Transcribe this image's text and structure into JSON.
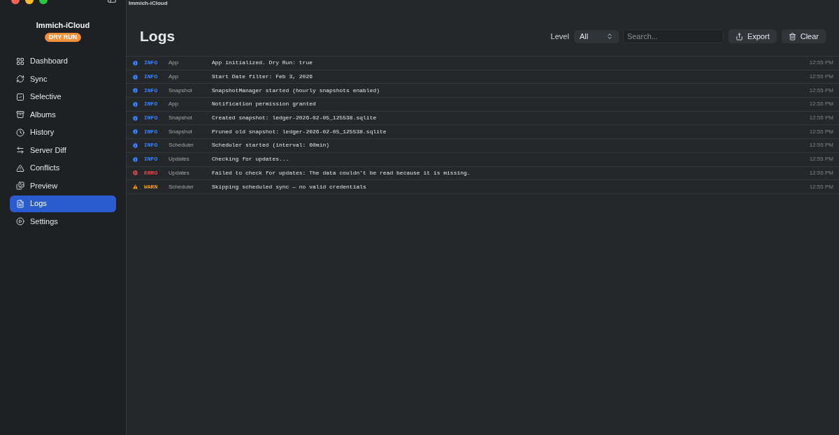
{
  "window": {
    "title": "Immich-iCloud"
  },
  "sidebar": {
    "app_name": "Immich-iCloud",
    "badge": "DRY RUN",
    "items": [
      {
        "label": "Dashboard",
        "selected": false
      },
      {
        "label": "Sync",
        "selected": false
      },
      {
        "label": "Selective",
        "selected": false
      },
      {
        "label": "Albums",
        "selected": false
      },
      {
        "label": "History",
        "selected": false
      },
      {
        "label": "Server Diff",
        "selected": false
      },
      {
        "label": "Conflicts",
        "selected": false
      },
      {
        "label": "Preview",
        "selected": false
      },
      {
        "label": "Logs",
        "selected": true
      },
      {
        "label": "Settings",
        "selected": false
      }
    ]
  },
  "header": {
    "title": "Logs",
    "level_label": "Level",
    "level_value": "All",
    "search": {
      "placeholder": "Search..."
    },
    "buttons": [
      {
        "label": "Export",
        "kind": "export"
      },
      {
        "label": "Clear",
        "kind": "clear"
      }
    ]
  },
  "logs": [
    {
      "kind": "info",
      "level": "INFO",
      "source": "App",
      "message": "App initialized. Dry Run: true",
      "time": "12:55 PM"
    },
    {
      "kind": "info",
      "level": "INFO",
      "source": "App",
      "message": "Start Date filter: Feb 3, 2026",
      "time": "12:55 PM"
    },
    {
      "kind": "info",
      "level": "INFO",
      "source": "Snapshot",
      "message": "SnapshotManager started (hourly snapshots enabled)",
      "time": "12:55 PM"
    },
    {
      "kind": "info",
      "level": "INFO",
      "source": "App",
      "message": "Notification permission granted",
      "time": "12:55 PM"
    },
    {
      "kind": "info",
      "level": "INFO",
      "source": "Snapshot",
      "message": "Created snapshot: ledger-2026-02-05_125538.sqlite",
      "time": "12:55 PM"
    },
    {
      "kind": "info",
      "level": "INFO",
      "source": "Snapshot",
      "message": "Pruned old snapshot: ledger-2026-02-05_125538.sqlite",
      "time": "12:55 PM"
    },
    {
      "kind": "info",
      "level": "INFO",
      "source": "Scheduler",
      "message": "Scheduler started (interval: 60min)",
      "time": "12:55 PM"
    },
    {
      "kind": "info",
      "level": "INFO",
      "source": "Updates",
      "message": "Checking for updates...",
      "time": "12:55 PM"
    },
    {
      "kind": "error",
      "level": "ERRO",
      "source": "Updates",
      "message": "Failed to check for updates: The data couldn’t be read because it is missing.",
      "time": "12:55 PM"
    },
    {
      "kind": "warn",
      "level": "WARN",
      "source": "Scheduler",
      "message": "Skipping scheduled sync — no valid credentials",
      "time": "12:55 PM"
    }
  ]
}
